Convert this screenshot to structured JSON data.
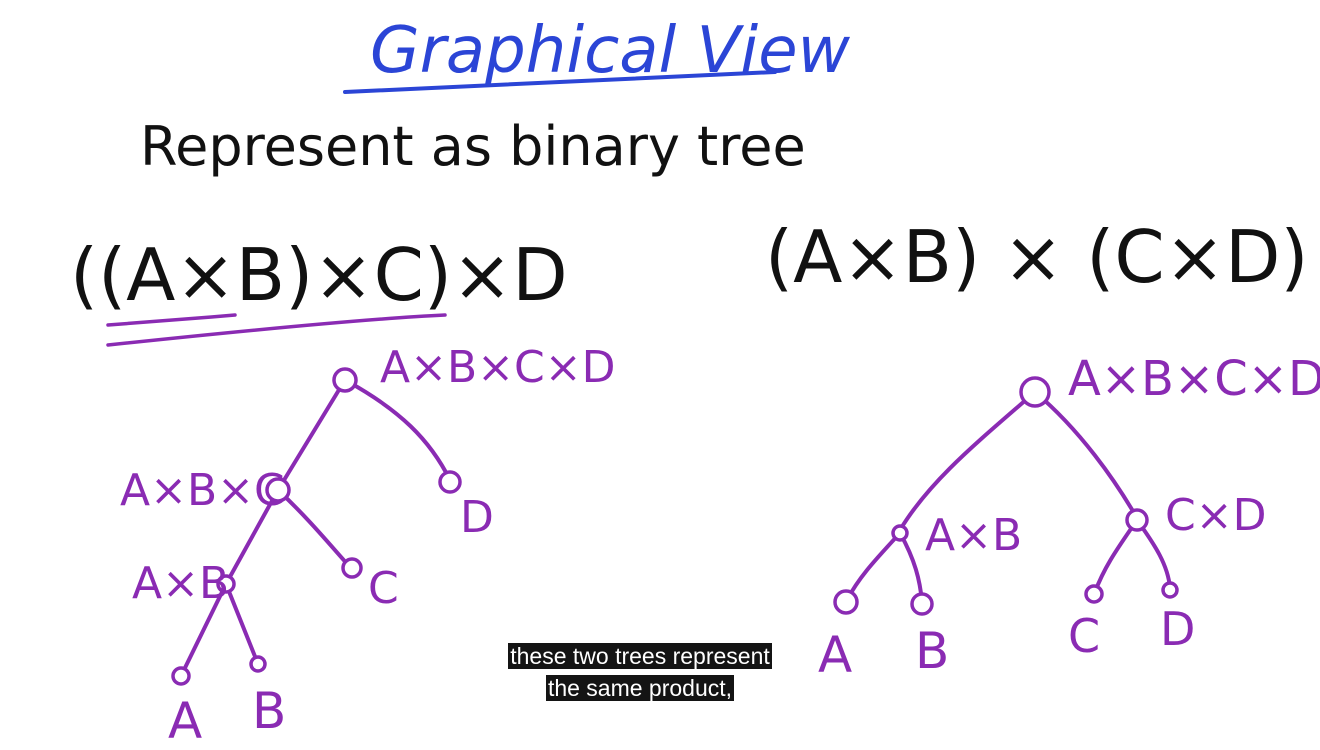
{
  "title": "Graphical View",
  "subtitle": "Represent as binary tree",
  "left_expression": "((A×B)×C)×D",
  "right_expression": "(A×B) × (C×D)",
  "left_tree": {
    "root": "A×B×C×D",
    "n1": "A×B×C",
    "n2": "D",
    "n3": "A×B",
    "n4": "C",
    "n5": "A",
    "n6": "B"
  },
  "right_tree": {
    "root": "A×B×C×D",
    "n1": "A×B",
    "n2": "C×D",
    "n3": "A",
    "n4": "B",
    "n5": "C",
    "n6": "D"
  },
  "subtitles": {
    "line1": "these two trees represent",
    "line2": "the same product,"
  },
  "colors": {
    "title": "#2b45d6",
    "ink": "#111111",
    "tree": "#8a2bb3",
    "caption_bg": "#141414"
  }
}
